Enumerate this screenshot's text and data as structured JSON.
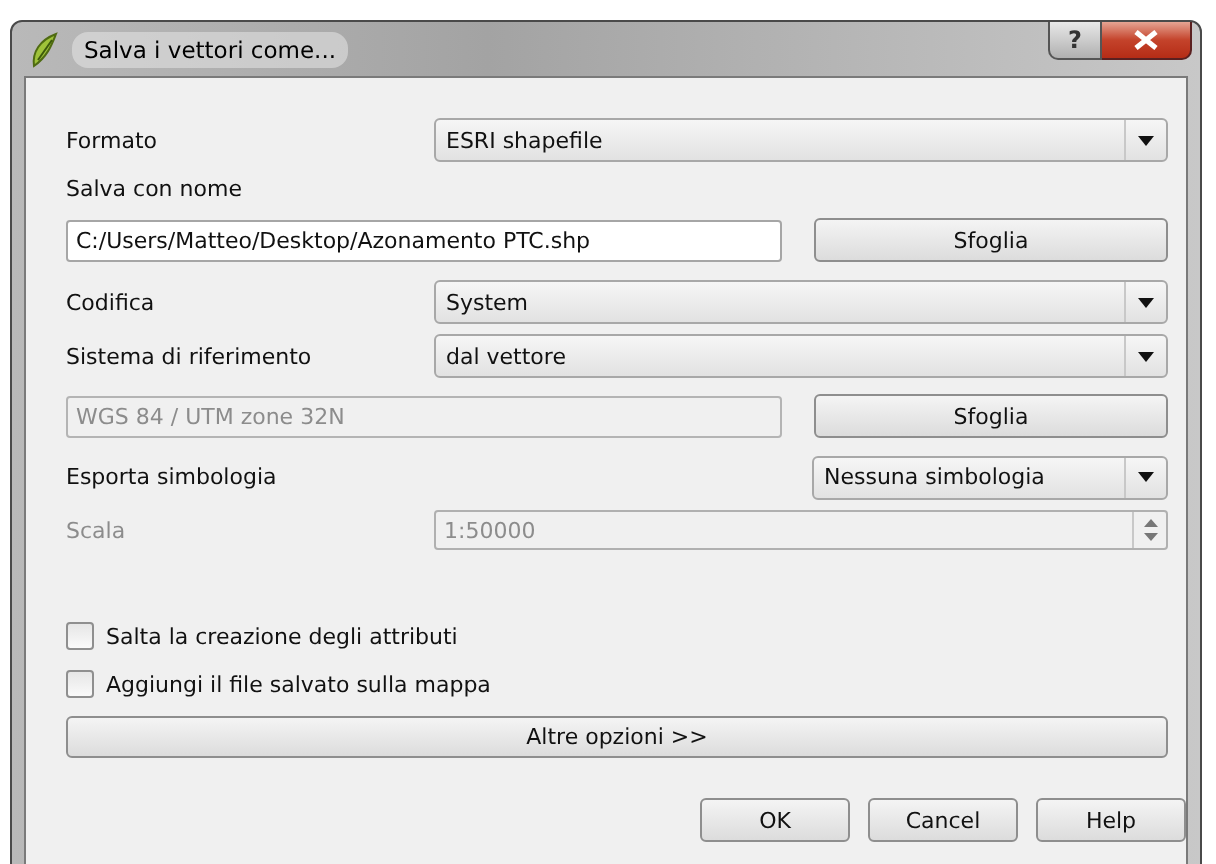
{
  "window": {
    "title": "Salva i vettori come...",
    "help_button": "?"
  },
  "format": {
    "label": "Formato",
    "value": "ESRI shapefile"
  },
  "file": {
    "label": "Salva con nome",
    "value": "C:/Users/Matteo/Desktop/Azonamento PTC.shp",
    "button": "Sfoglia"
  },
  "encoding": {
    "label": "Codifica",
    "value": "System"
  },
  "crs": {
    "label": "Sistema di riferimento",
    "value": "dal vettore",
    "field_value": "WGS 84 / UTM zone 32N",
    "field_disabled": true,
    "button": "Sfoglia"
  },
  "symbology": {
    "label": "Esporta simbologia",
    "value": "Nessuna simbologia"
  },
  "scale": {
    "label": "Scala",
    "value": "1:50000",
    "disabled": true
  },
  "checkboxes": [
    {
      "label": "Salta la creazione degli attributi",
      "checked": false
    },
    {
      "label": "Aggiungi il file salvato sulla mappa",
      "checked": false
    }
  ],
  "more_button": "Altre opzioni >>",
  "buttons": [
    "OK",
    "Cancel",
    "Help"
  ]
}
